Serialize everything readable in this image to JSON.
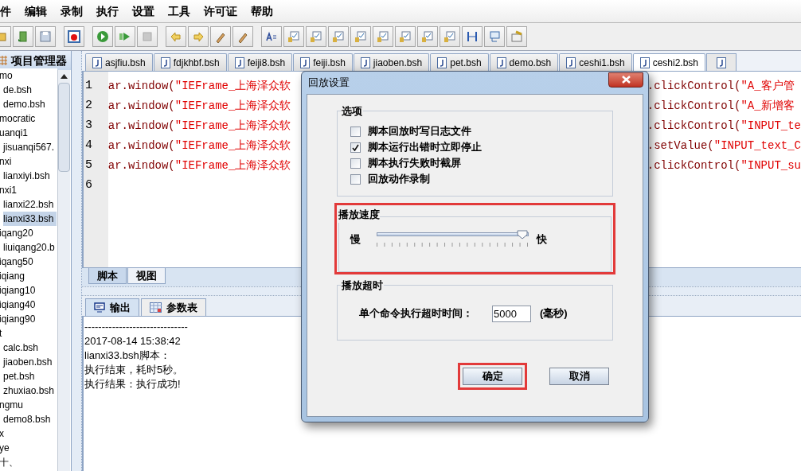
{
  "menu": [
    "件",
    "编辑",
    "录制",
    "执行",
    "设置",
    "工具",
    "许可证",
    "帮助"
  ],
  "project_panel": {
    "title": "项目管理器",
    "tree": [
      {
        "label": "mo",
        "selected": false,
        "children": [
          {
            "label": "de.bsh",
            "selected": false
          },
          {
            "label": "demo.bsh",
            "selected": false
          }
        ]
      },
      {
        "label": "mocratic",
        "selected": false
      },
      {
        "label": "uanqi1",
        "selected": false,
        "children": [
          {
            "label": "jisuanqi567.",
            "selected": false
          }
        ]
      },
      {
        "label": "nxi",
        "selected": false,
        "children": [
          {
            "label": "lianxiyi.bsh",
            "selected": false
          }
        ]
      },
      {
        "label": "nxi1",
        "selected": false,
        "children": [
          {
            "label": "lianxi22.bsh",
            "selected": false
          },
          {
            "label": "lianxi33.bsh",
            "selected": true
          }
        ]
      },
      {
        "label": "iqang20",
        "selected": false,
        "children": [
          {
            "label": "liuiqang20.b",
            "selected": false
          }
        ]
      },
      {
        "label": "iqang50",
        "selected": false
      },
      {
        "label": "iqiang",
        "selected": false
      },
      {
        "label": "iqiang10",
        "selected": false
      },
      {
        "label": "iqiang40",
        "selected": false
      },
      {
        "label": "iqiang90",
        "selected": false
      },
      {
        "label": "t",
        "selected": false,
        "children": [
          {
            "label": "calc.bsh",
            "selected": false
          },
          {
            "label": "jiaoben.bsh",
            "selected": false
          },
          {
            "label": "pet.bsh",
            "selected": false
          },
          {
            "label": "zhuxiao.bsh",
            "selected": false
          }
        ]
      },
      {
        "label": "ngmu",
        "selected": false,
        "children": [
          {
            "label": "demo8.bsh",
            "selected": false
          }
        ]
      },
      {
        "label": "x",
        "selected": false
      },
      {
        "label": "ye",
        "selected": false
      },
      {
        "label": "十、",
        "selected": false
      }
    ]
  },
  "file_tabs": [
    {
      "label": "asjfiu.bsh",
      "selected": false
    },
    {
      "label": "fdjkhbf.bsh",
      "selected": false
    },
    {
      "label": "feiji8.bsh",
      "selected": false
    },
    {
      "label": "feiji.bsh",
      "selected": false
    },
    {
      "label": "jiaoben.bsh",
      "selected": false
    },
    {
      "label": "pet.bsh",
      "selected": false
    },
    {
      "label": "demo.bsh",
      "selected": false
    },
    {
      "label": "ceshi1.bsh",
      "selected": false
    },
    {
      "label": "ceshi2.bsh",
      "selected": true
    }
  ],
  "editor": {
    "lines": [
      {
        "number": "1",
        "head": "ar.window(",
        "head_string": "\"IEFrame_上海泽众软",
        "tail": ".clickControl(",
        "tail_string": "\"A_客户管"
      },
      {
        "number": "2",
        "head": "ar.window(",
        "head_string": "\"IEFrame_上海泽众软",
        "tail": ".clickControl(",
        "tail_string": "\"A_新增客"
      },
      {
        "number": "3",
        "head": "ar.window(",
        "head_string": "\"IEFrame_上海泽众软",
        "tail": ".clickControl(",
        "tail_string": "\"INPUT_te"
      },
      {
        "number": "4",
        "head": "ar.window(",
        "head_string": "\"IEFrame_上海泽众软",
        "tail": ".setValue(",
        "tail_string": "\"INPUT_text_C"
      },
      {
        "number": "5",
        "head": "ar.window(",
        "head_string": "\"IEFrame_上海泽众软",
        "tail": ".clickControl(",
        "tail_string": "\"INPUT_su"
      },
      {
        "number": "6"
      }
    ],
    "view_tabs": [
      {
        "label": "脚本",
        "selected": true
      },
      {
        "label": "视图",
        "selected": false
      }
    ]
  },
  "output": {
    "tabs": [
      {
        "label": "输出",
        "selected": true
      },
      {
        "label": "参数表",
        "selected": false
      }
    ],
    "lines": [
      "------------------------------",
      "2017-08-14 15:38:42",
      "lianxi33.bsh脚本：",
      "执行结束，耗时5秒。",
      "执行结果：执行成功!"
    ]
  },
  "dialog": {
    "title": "回放设置",
    "options": {
      "title": "选项",
      "items": [
        {
          "label": "脚本回放时写日志文件",
          "checked": false
        },
        {
          "label": "脚本运行出错时立即停止",
          "checked": true
        },
        {
          "label": "脚本执行失败时截屏",
          "checked": false
        },
        {
          "label": "回放动作录制",
          "checked": false
        }
      ]
    },
    "speed": {
      "title": "播放速度",
      "highlighted": true,
      "slow_label": "慢",
      "fast_label": "快",
      "level": 0.96
    },
    "timeout": {
      "title": "播放超时",
      "label": "单个命令执行超时时间：",
      "value": "5000",
      "unit": "(毫秒)"
    },
    "buttons": [
      {
        "label": "确定",
        "highlighted": true
      },
      {
        "label": "取消",
        "highlighted": false
      }
    ]
  }
}
